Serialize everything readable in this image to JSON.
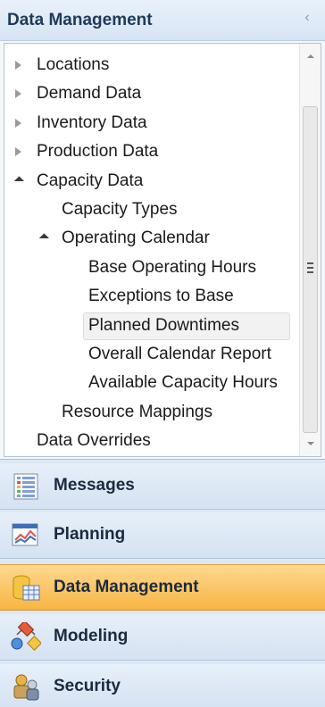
{
  "header": {
    "title": "Data Management",
    "collapse_glyph": "‹",
    "collapse_icon": "chevron-left-icon"
  },
  "tree": {
    "items": [
      {
        "label": "Locations",
        "level": 0,
        "expander": "collapsed"
      },
      {
        "label": "Demand Data",
        "level": 0,
        "expander": "collapsed"
      },
      {
        "label": "Inventory Data",
        "level": 0,
        "expander": "collapsed"
      },
      {
        "label": "Production Data",
        "level": 0,
        "expander": "collapsed"
      },
      {
        "label": "Capacity Data",
        "level": 0,
        "expander": "expanded"
      },
      {
        "label": "Capacity Types",
        "level": 1,
        "expander": "none"
      },
      {
        "label": "Operating Calendar",
        "level": 1,
        "expander": "expanded"
      },
      {
        "label": "Base Operating Hours",
        "level": 2,
        "expander": "none"
      },
      {
        "label": "Exceptions to Base",
        "level": 2,
        "expander": "none"
      },
      {
        "label": "Planned Downtimes",
        "level": 2,
        "expander": "none",
        "selected": true
      },
      {
        "label": "Overall Calendar Report",
        "level": 2,
        "expander": "none"
      },
      {
        "label": "Available Capacity Hours",
        "level": 2,
        "expander": "none"
      },
      {
        "label": "Resource Mappings",
        "level": 1,
        "expander": "none"
      },
      {
        "label": "Data Overrides",
        "level": 0,
        "expander": "none"
      }
    ]
  },
  "nav": {
    "buttons": [
      {
        "label": "Messages",
        "icon": "messages-grid-icon",
        "active": false
      },
      {
        "label": "Planning",
        "icon": "planning-chart-icon",
        "active": false
      },
      {
        "label": "Data Management",
        "icon": "database-table-icon",
        "active": true
      },
      {
        "label": "Modeling",
        "icon": "modeling-shapes-icon",
        "active": false
      },
      {
        "label": "Security",
        "icon": "security-keys-icon",
        "active": false
      }
    ]
  },
  "colors": {
    "header_text": "#1e3a5a",
    "active_nav": "#f8b544",
    "selection_bg": "#f2f2f2"
  }
}
